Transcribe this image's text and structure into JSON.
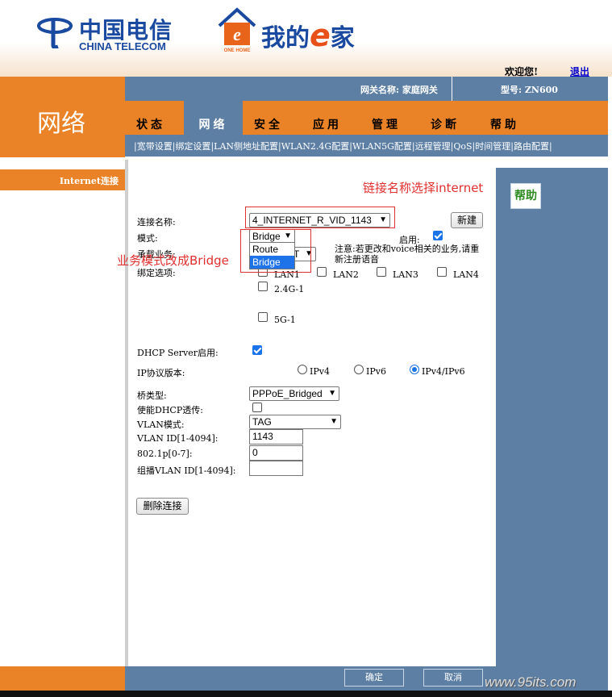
{
  "header": {
    "brand_cn": "中国电信",
    "brand_en": "CHINA TELECOM",
    "ehome_title_pre": "我的",
    "ehome_title_e": "e",
    "ehome_title_post": "家",
    "ehome_badge": "ONE HOME",
    "welcome": "欢迎您!",
    "logout": "退出"
  },
  "topbar": {
    "section_title": "网络",
    "gateway_name": "网关名称: 家庭网关",
    "model": "型号: ZN600"
  },
  "tabs": [
    {
      "label": "状态",
      "active": false
    },
    {
      "label": "网络",
      "active": true
    },
    {
      "label": "安全",
      "active": false
    },
    {
      "label": "应用",
      "active": false
    },
    {
      "label": "管理",
      "active": false
    },
    {
      "label": "诊断",
      "active": false
    },
    {
      "label": "帮助",
      "active": false
    }
  ],
  "subnav": [
    "宽带设置",
    "绑定设置",
    "LAN侧地址配置",
    "WLAN2.4G配置",
    "WLAN5G配置",
    "远程管理",
    "QoS",
    "时间管理",
    "路由配置"
  ],
  "sidebar": {
    "item": "Internet连接"
  },
  "help_label": "帮助",
  "form": {
    "conn_name_label": "连接名称:",
    "conn_name_value": "4_INTERNET_R_VID_1143",
    "new_button": "新建",
    "mode_label": "模式:",
    "mode_value": "Bridge",
    "mode_options": [
      "Route",
      "Bridge"
    ],
    "enable_label": "启用:",
    "enable_checked": true,
    "service_label": "承载业务:",
    "service_value": "T",
    "note": "注意:若更改和voice相关的业务,请重新注册语音",
    "bind_label": "绑定选项:",
    "bind_options": [
      {
        "label": "LAN1",
        "checked": false
      },
      {
        "label": "LAN2",
        "checked": false
      },
      {
        "label": "LAN3",
        "checked": false
      },
      {
        "label": "LAN4",
        "checked": false
      },
      {
        "label": "2.4G-1",
        "checked": false
      },
      {
        "label": "5G-1",
        "checked": false
      }
    ],
    "dhcp_label": "DHCP Server启用:",
    "dhcp_checked": true,
    "ip_label": "IP协议版本:",
    "ip_options": [
      "IPv4",
      "IPv6",
      "IPv4/IPv6"
    ],
    "ip_selected": "IPv4/IPv6",
    "bridge_type_label": "桥类型:",
    "bridge_type_value": "PPPoE_Bridged",
    "dhcp_passthrough_label": "使能DHCP透传:",
    "dhcp_passthrough_checked": false,
    "vlan_mode_label": "VLAN模式:",
    "vlan_mode_value": "TAG",
    "vlan_id_label": "VLAN ID[1-4094]:",
    "vlan_id_value": "1143",
    "dot1p_label": "802.1p[0-7]:",
    "dot1p_value": "0",
    "mcast_vlan_label": "组播VLAN ID[1-4094]:",
    "mcast_vlan_value": "",
    "delete_button": "删除连接"
  },
  "annotations": {
    "conn_note": "链接名称选择internet",
    "mode_note": "业务模式改成Bridge"
  },
  "footer": {
    "ok": "确定",
    "cancel": "取消",
    "watermark": "www.95its.com"
  },
  "colors": {
    "orange": "#ea8327",
    "steel_blue": "#5d7fa4",
    "brand_blue": "#1a4aa0",
    "annotation_red": "#e03030"
  }
}
